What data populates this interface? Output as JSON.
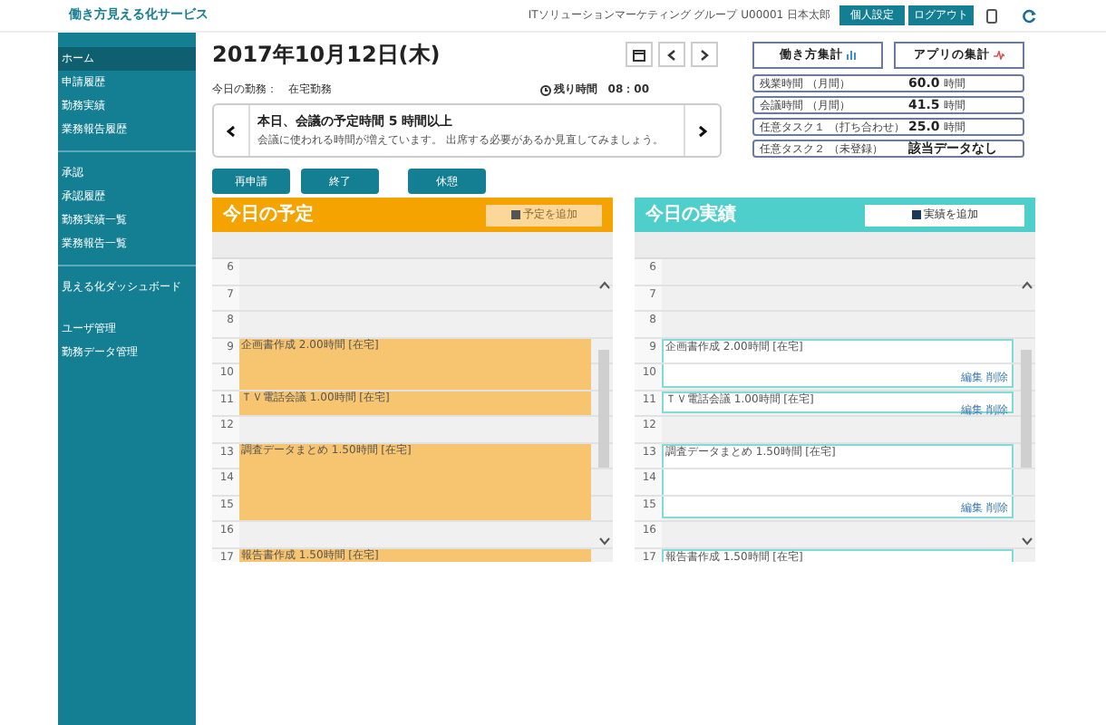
{
  "app_title": "働き方見える化サービス",
  "user_info": "ITソリューションマーケティング グループ U00001 日本太郎",
  "header_buttons": [
    "個人設定",
    "ログアウト"
  ],
  "sidebar": {
    "groups": [
      {
        "items": [
          {
            "label": "ホーム",
            "selected": true
          },
          {
            "label": "申請履歴",
            "selected": false
          },
          {
            "label": "勤務実績",
            "selected": false
          },
          {
            "label": "業務報告履歴",
            "selected": false
          }
        ]
      },
      {
        "items": [
          {
            "label": "承認",
            "selected": false
          },
          {
            "label": "承認履歴",
            "selected": false
          },
          {
            "label": "勤務実績一覧",
            "selected": false
          },
          {
            "label": "業務報告一覧",
            "selected": false
          }
        ]
      },
      {
        "items": [
          {
            "label": "見える化ダッシュボード",
            "selected": false
          }
        ]
      },
      {
        "items": [
          {
            "label": "ユーザ管理",
            "selected": false
          },
          {
            "label": "勤務データ管理",
            "selected": false
          }
        ]
      }
    ]
  },
  "date": "2017年10月12日(木)",
  "work_style": {
    "label": "今日の勤務：",
    "value": "在宅勤務"
  },
  "remaining": {
    "label": "残り時間",
    "value": "08：00"
  },
  "notice": {
    "title": "本日、会議の予定時間 5 時間以上",
    "text": "会議に使われる時間が増えています。 出席する必要があるか見直してみましょう。"
  },
  "summary_buttons": [
    "働き方集計",
    "アプリの集計"
  ],
  "stats": [
    {
      "label": "残業時間 （月間）",
      "value": "60.0",
      "unit": "時間"
    },
    {
      "label": "会議時間 （月間）",
      "value": "41.5",
      "unit": "時間"
    },
    {
      "label": "任意タスク１ （打ち合わせ）",
      "value": "25.0",
      "unit": "時間"
    },
    {
      "label": "任意タスク２ （未登録）",
      "value": "該当データなし"
    }
  ],
  "action_buttons": [
    "再申請",
    "終了",
    "休憩"
  ],
  "panels": [
    {
      "kind": "plan",
      "title": "今日の予定",
      "add_button": "予定を追加",
      "rows": [
        {
          "hour": "6",
          "kind": "free"
        },
        {
          "hour": "7",
          "kind": "free"
        },
        {
          "hour": "8",
          "kind": "free"
        },
        {
          "hour": "9",
          "kind": "start",
          "event": "企画書作成 2.00時間 [在宅]"
        },
        {
          "hour": "10",
          "kind": "cont"
        },
        {
          "hour": "11",
          "kind": "start",
          "event": "ＴＶ電話会議 1.00時間 [在宅]"
        },
        {
          "hour": "12",
          "kind": "free"
        },
        {
          "hour": "13",
          "kind": "start",
          "event": "調査データまとめ 1.50時間 [在宅]"
        },
        {
          "hour": "14",
          "kind": "cont"
        },
        {
          "hour": "15",
          "kind": "cont"
        },
        {
          "hour": "16",
          "kind": "free"
        },
        {
          "hour": "17",
          "kind": "start",
          "event": "報告書作成 1.50時間 [在宅]"
        }
      ]
    },
    {
      "kind": "actual",
      "title": "今日の実績",
      "add_button": "実績を追加",
      "rows": [
        {
          "hour": "6",
          "kind": "free"
        },
        {
          "hour": "7",
          "kind": "free"
        },
        {
          "hour": "8",
          "kind": "free"
        },
        {
          "hour": "9",
          "kind": "start",
          "event": "企画書作成 2.00時間 [在宅]"
        },
        {
          "hour": "10",
          "kind": "cont",
          "links": [
            "編集",
            "削除"
          ]
        },
        {
          "hour": "11",
          "kind": "start",
          "event": "ＴＶ電話会議 1.00時間 [在宅]",
          "links": [
            "編集",
            "削除"
          ]
        },
        {
          "hour": "12",
          "kind": "free"
        },
        {
          "hour": "13",
          "kind": "start",
          "event": "調査データまとめ 1.50時間 [在宅]"
        },
        {
          "hour": "14",
          "kind": "cont"
        },
        {
          "hour": "15",
          "kind": "cont",
          "links": [
            "編集",
            "削除"
          ]
        },
        {
          "hour": "16",
          "kind": "free"
        },
        {
          "hour": "17",
          "kind": "start",
          "event": "報告書作成 1.50時間 [在宅]"
        }
      ]
    }
  ]
}
